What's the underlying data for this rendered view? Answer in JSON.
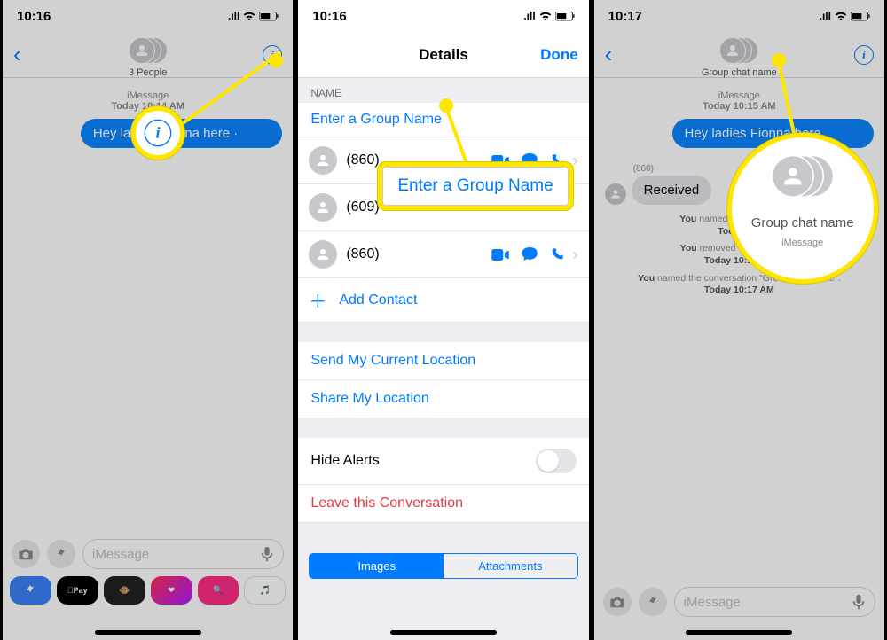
{
  "status": {
    "time1": "10:16",
    "time2": "10:16",
    "time3": "10:17",
    "icons": "􀙇 ▮▯"
  },
  "signal": ".ıll",
  "panel1": {
    "subtitle": "3 People",
    "thread_meta_service": "iMessage",
    "thread_meta_time": "Today 10:14 AM",
    "bubble": "Hey ladies Fionna here ·",
    "input_placeholder": "iMessage"
  },
  "panel2": {
    "title": "Details",
    "done": "Done",
    "section_name": "NAME",
    "group_name_placeholder": "Enter a Group Name",
    "contacts": [
      "(860)",
      "(609)",
      "(860)"
    ],
    "add_contact": "Add Contact",
    "send_location": "Send My Current Location",
    "share_location": "Share My Location",
    "hide_alerts": "Hide Alerts",
    "leave": "Leave this Conversation",
    "seg_images": "Images",
    "seg_attachments": "Attachments",
    "callout_text": "Enter a Group Name"
  },
  "panel3": {
    "subtitle": "Group chat name",
    "thread_meta_service": "iMessage",
    "thread_meta_time": "Today 10:15 AM",
    "bubble": "Hey ladies Fionna here",
    "sender": "(860)",
    "reply": "Received",
    "sys1_a": "You",
    "sys1_b": " named the conversation",
    "sys1_t": "Today 10:",
    "sys2_a": "You",
    "sys2_b": " removed the name from",
    "sys2_t": "Today 10:16 AM",
    "sys3_a": "You",
    "sys3_b": " named the conversation \"Group chat name\".",
    "sys3_t": "Today 10:17 AM",
    "callout_sub": "Group chat name",
    "callout_meta": "iMessage",
    "input_placeholder": "iMessage"
  }
}
